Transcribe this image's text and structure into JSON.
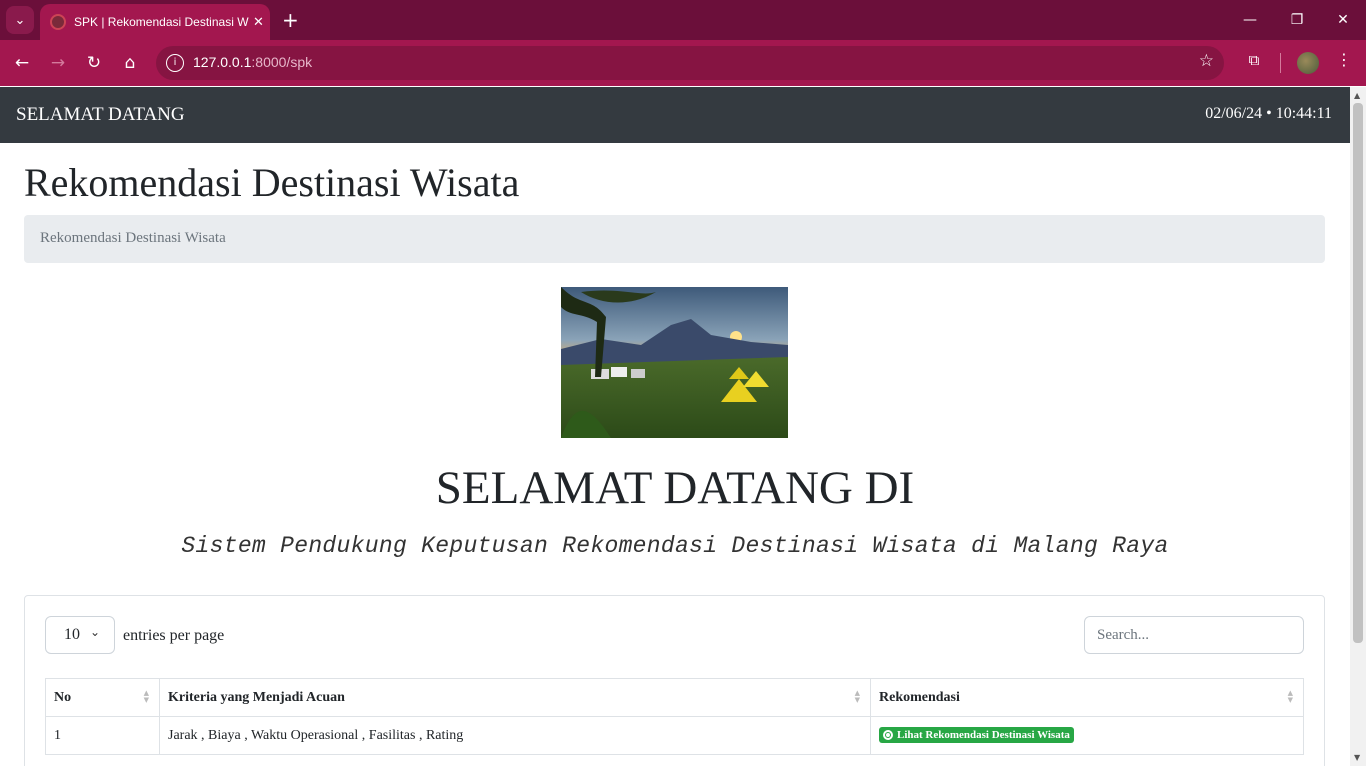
{
  "browser": {
    "tab_title": "SPK | Rekomendasi Destinasi W",
    "tab_close": "✕",
    "new_tab": "+",
    "url_host": "127.0.0.1",
    "url_path": ":8000/spk",
    "controls": {
      "minimize": "—",
      "restore": "❐",
      "close": "✕"
    }
  },
  "navbar": {
    "brand": "SELAMAT DATANG",
    "datetime": "02/06/24 • 10:44:11"
  },
  "page": {
    "title": "Rekomendasi Destinasi Wisata",
    "breadcrumb": "Rekomendasi Destinasi Wisata"
  },
  "hero": {
    "title": "SELAMAT DATANG DI",
    "subtitle": "Sistem Pendukung Keputusan Rekomendasi Destinasi Wisata di Malang Raya"
  },
  "datatable": {
    "per_page_value": "10",
    "per_page_label": "entries per page",
    "search_placeholder": "Search...",
    "columns": [
      "No",
      "Kriteria yang Menjadi Acuan",
      "Rekomendasi"
    ],
    "rows": [
      {
        "no": "1",
        "kriteria": "Jarak , Biaya , Waktu Operasional , Fasilitas , Rating",
        "button": "Lihat Rekomendasi Destinasi Wisata"
      }
    ]
  },
  "icons": [
    "chevron-down-icon",
    "back-icon",
    "forward-icon",
    "reload-icon",
    "home-icon",
    "site-info-icon",
    "star-icon",
    "extensions-icon",
    "kebab-icon",
    "eye-icon",
    "sort-icon"
  ],
  "colors": {
    "tab_strip": "#6b0f3a",
    "toolbar": "#a3174f",
    "navbar": "#343a40",
    "breadcrumb_bg": "#e9ecef",
    "button_green": "#28a745"
  }
}
